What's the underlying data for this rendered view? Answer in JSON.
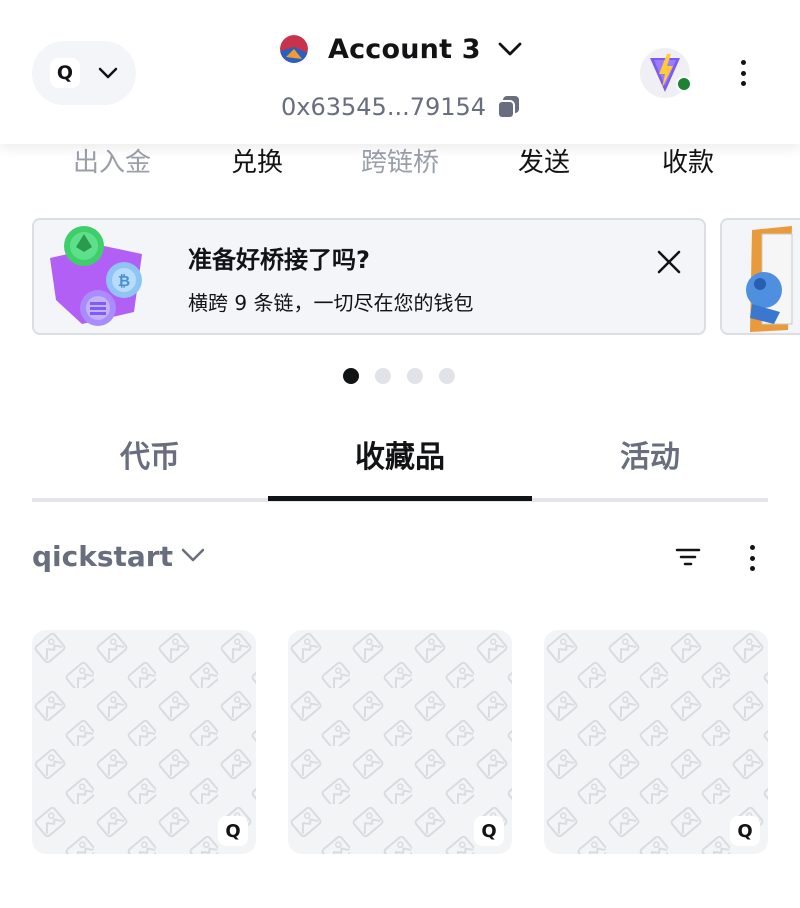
{
  "header": {
    "network_letter": "Q",
    "account_name": "Account 3",
    "address": "0x63545...79154"
  },
  "actions": [
    {
      "label": "出入金",
      "enabled": false
    },
    {
      "label": "兑换",
      "enabled": true
    },
    {
      "label": "跨链桥",
      "enabled": false
    },
    {
      "label": "发送",
      "enabled": true
    },
    {
      "label": "收款",
      "enabled": true
    }
  ],
  "banner": {
    "title": "准备好桥接了吗?",
    "subtitle": "横跨 9 条链，一切尽在您的钱包"
  },
  "carousel": {
    "count": 4,
    "active": 0
  },
  "tabs": [
    {
      "label": "代币",
      "active": false
    },
    {
      "label": "收藏品",
      "active": true
    },
    {
      "label": "活动",
      "active": false
    }
  ],
  "collection": {
    "name": "qickstart",
    "badge_letter": "Q",
    "items": [
      {
        "badge": "Q"
      },
      {
        "badge": "Q"
      },
      {
        "badge": "Q"
      }
    ]
  },
  "colors": {
    "accent_dark": "#121314",
    "muted_text": "#686e7d",
    "online": "#1c8234",
    "surface": "#f3f5f9"
  }
}
